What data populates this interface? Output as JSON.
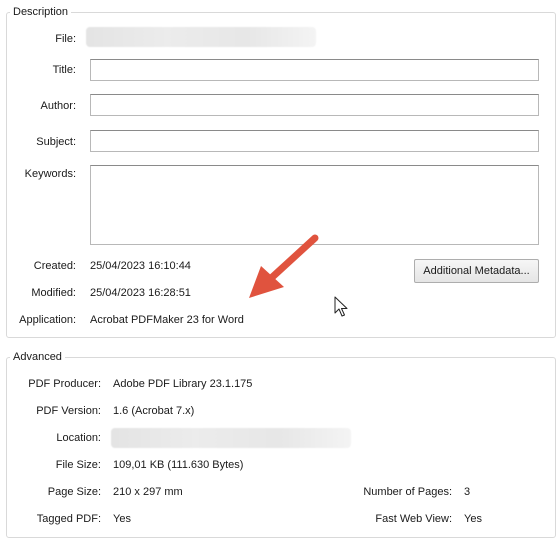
{
  "description": {
    "legend": "Description",
    "file_label": "File:",
    "title_label": "Title:",
    "title_value": "",
    "author_label": "Author:",
    "author_value": "",
    "subject_label": "Subject:",
    "subject_value": "",
    "keywords_label": "Keywords:",
    "keywords_value": "",
    "created_label": "Created:",
    "created_value": "25/04/2023 16:10:44",
    "modified_label": "Modified:",
    "modified_value": "25/04/2023 16:28:51",
    "application_label": "Application:",
    "application_value": "Acrobat PDFMaker 23 for Word",
    "additional_metadata_button": "Additional Metadata..."
  },
  "advanced": {
    "legend": "Advanced",
    "pdf_producer_label": "PDF Producer:",
    "pdf_producer_value": "Adobe PDF Library 23.1.175",
    "pdf_version_label": "PDF Version:",
    "pdf_version_value": "1.6 (Acrobat 7.x)",
    "location_label": "Location:",
    "file_size_label": "File Size:",
    "file_size_value": "109,01 KB (111.630 Bytes)",
    "page_size_label": "Page Size:",
    "page_size_value": "210 x 297 mm",
    "number_of_pages_label": "Number of Pages:",
    "number_of_pages_value": "3",
    "tagged_pdf_label": "Tagged PDF:",
    "tagged_pdf_value": "Yes",
    "fast_web_view_label": "Fast Web View:",
    "fast_web_view_value": "Yes"
  },
  "annotation": {
    "arrow_color": "#e0533e",
    "arrow_icon": "red-arrow-icon",
    "cursor_icon": "mouse-pointer-icon"
  }
}
